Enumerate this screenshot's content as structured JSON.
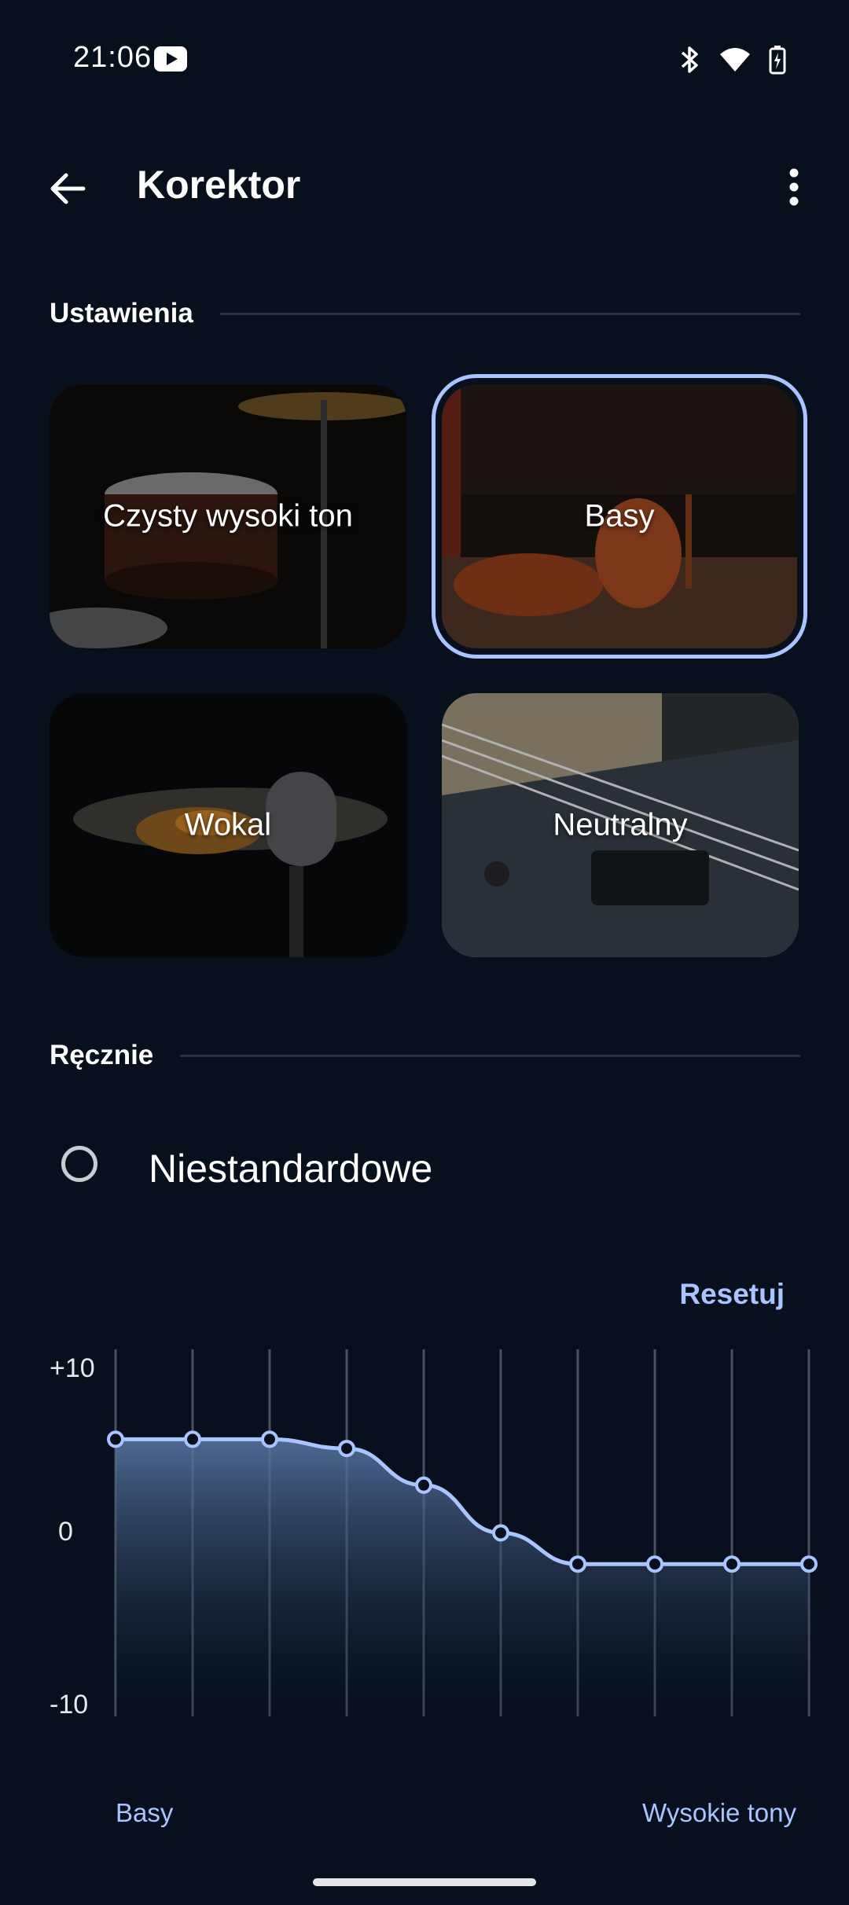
{
  "status_bar": {
    "time": "21:06",
    "icons": [
      "youtube-icon",
      "bluetooth-icon",
      "wifi-icon",
      "battery-charging-icon"
    ]
  },
  "app_bar": {
    "title": "Korektor",
    "back_icon": "arrow-back-icon",
    "more_icon": "more-vert-icon"
  },
  "presets_section": {
    "title": "Ustawienia",
    "items": [
      {
        "label": "Czysty wysoki ton",
        "image": "drums",
        "selected": false
      },
      {
        "label": "Basy",
        "image": "orchestra-double-bass",
        "selected": true
      },
      {
        "label": "Wokal",
        "image": "microphone",
        "selected": false
      },
      {
        "label": "Neutralny",
        "image": "electric-guitar",
        "selected": false
      }
    ]
  },
  "manual_section": {
    "title": "Ręcznie",
    "custom_option": {
      "label": "Niestandardowe",
      "checked": false
    }
  },
  "equalizer": {
    "reset_label": "Resetuj",
    "y_axis": {
      "max_label": "+10",
      "mid_label": "0",
      "min_label": "-10",
      "min": -10,
      "max": 10
    },
    "bands": [
      5.1,
      5.1,
      5.1,
      4.6,
      2.6,
      0,
      -1.7,
      -1.7,
      -1.7,
      -1.7
    ],
    "x_start_label": "Basy",
    "x_end_label": "Wysokie tony",
    "colors": {
      "line": "#a9c5ff",
      "fill_top": "#5a78a8",
      "fill_bottom": "#07101c",
      "grid": "#4a5260"
    }
  }
}
